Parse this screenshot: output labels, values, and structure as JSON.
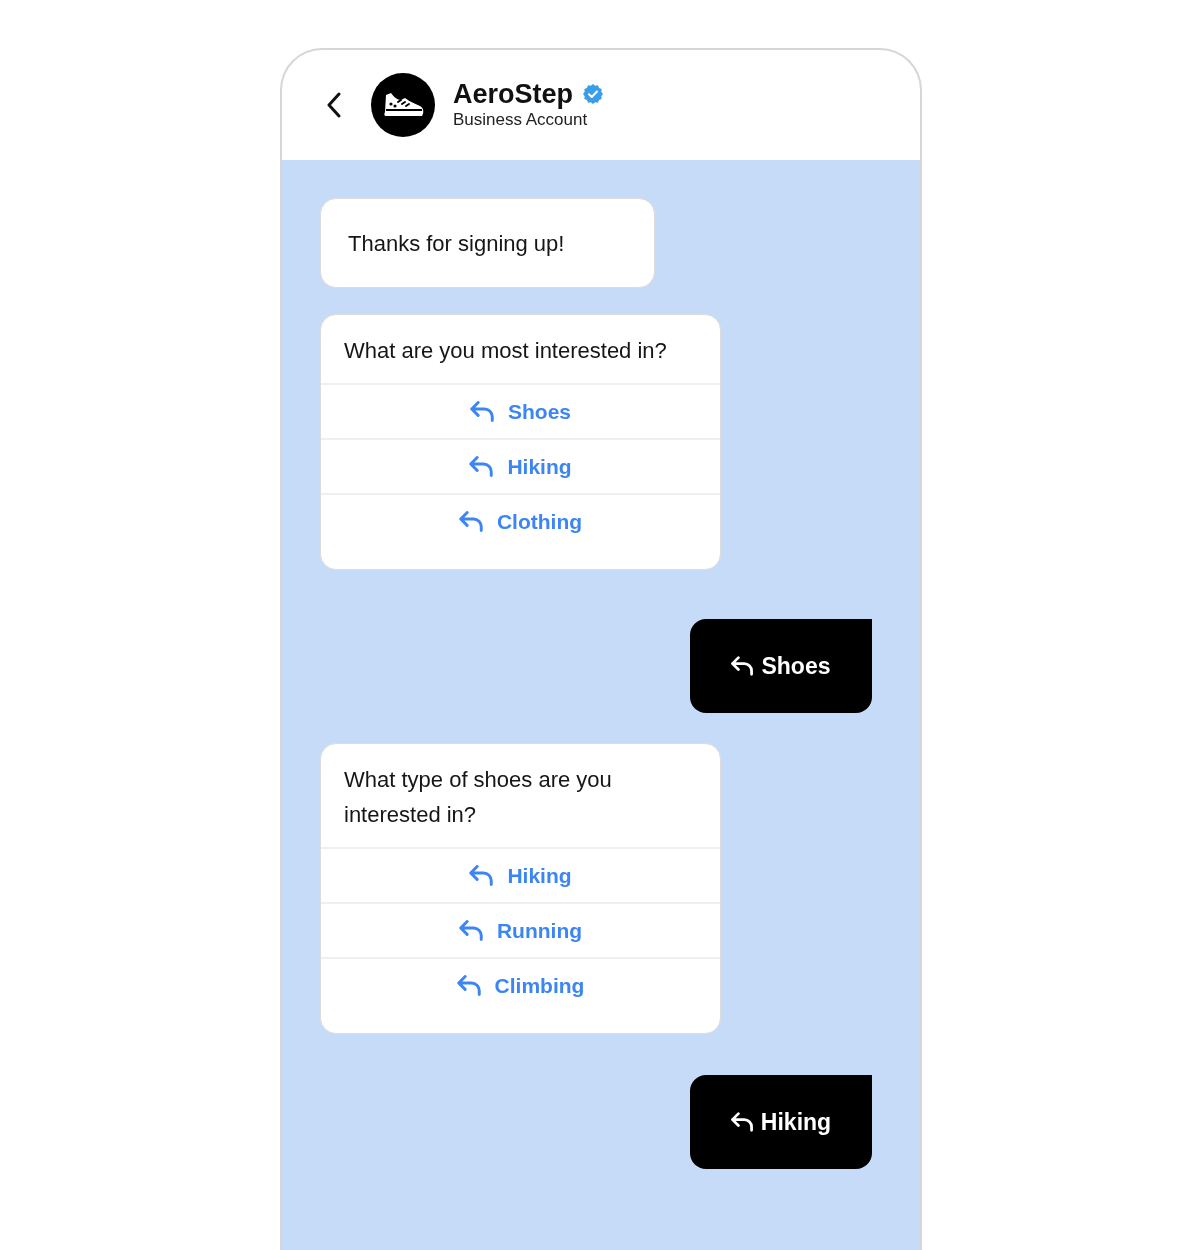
{
  "header": {
    "name": "AeroStep",
    "verified": true,
    "subtitle": "Business Account"
  },
  "messages": [
    {
      "kind": "text",
      "text": "Thanks for signing up!"
    },
    {
      "kind": "question",
      "text": "What are you most interested in?",
      "options": [
        "Shoes",
        "Hiking",
        "Clothing"
      ]
    },
    {
      "kind": "reply",
      "text": "Shoes"
    },
    {
      "kind": "question",
      "text": "What type of shoes are you interested in?",
      "options": [
        "Hiking",
        "Running",
        "Climbing"
      ]
    },
    {
      "kind": "reply",
      "text": "Hiking"
    }
  ]
}
